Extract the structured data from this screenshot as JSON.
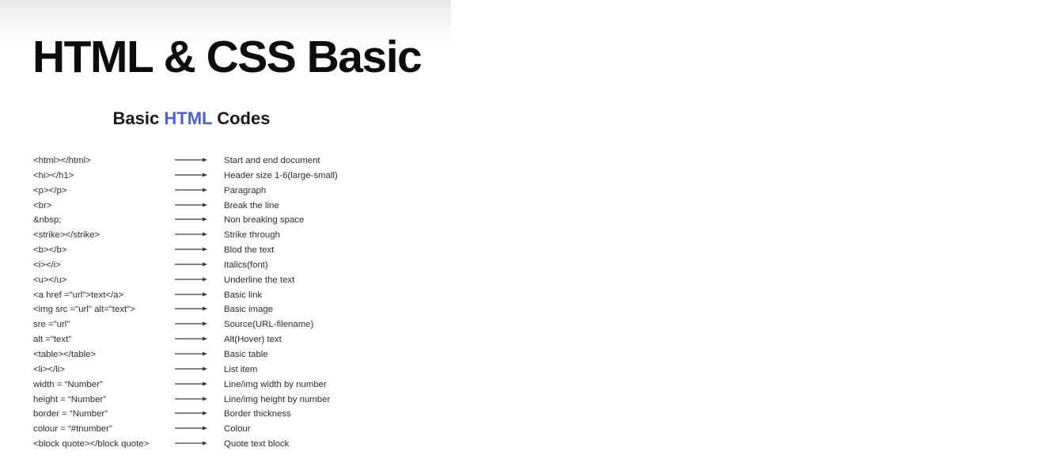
{
  "slide": {
    "title": "HTML & CSS Basic",
    "subtitle": {
      "prefix": "Basic ",
      "accent": "HTML",
      "suffix": " Codes",
      "accent_color": "#4f5fd1"
    }
  },
  "rows": [
    {
      "code": "<html></html>",
      "desc": "Start and end document"
    },
    {
      "code": "<hi></h1>",
      "desc": "Header size 1-6(large-small)"
    },
    {
      "code": "<p></p>",
      "desc": "Paragraph"
    },
    {
      "code": "<br>",
      "desc": "Break the line"
    },
    {
      "code": "&nbsp;",
      "desc": "Non breaking space"
    },
    {
      "code": "<strike></strike>",
      "desc": "Strike through"
    },
    {
      "code": "<b></b>",
      "desc": "Blod the text"
    },
    {
      "code": "<i></i>",
      "desc": "Italics(font)"
    },
    {
      "code": "<u></u>",
      "desc": "Underline the text"
    },
    {
      "code": "<a href =\"url\">text</a>",
      "desc": "Basic link"
    },
    {
      "code": "<img src =\"url\" alt=\"text\">",
      "desc": "Basic image"
    },
    {
      "code": "sre =\"url\"",
      "desc": "Source(URL-filename)"
    },
    {
      "code": "alt =\"text\"",
      "desc": "Alt(Hover) text"
    },
    {
      "code": "<table></table>",
      "desc": "Basic table"
    },
    {
      "code": "<li></li>",
      "desc": "List item"
    },
    {
      "code": "width = “Number”",
      "desc": "Line/img width by number"
    },
    {
      "code": "height = “Number”",
      "desc": "Line/img height by number"
    },
    {
      "code": "border = “Number”",
      "desc": "Border thickness"
    },
    {
      "code": "colour = “#tnumber”",
      "desc": "Colour"
    },
    {
      "code": "<block quote></block quote>",
      "desc": "Quote text block"
    }
  ],
  "icons": {
    "row_arrow": "right-arrow-icon"
  }
}
